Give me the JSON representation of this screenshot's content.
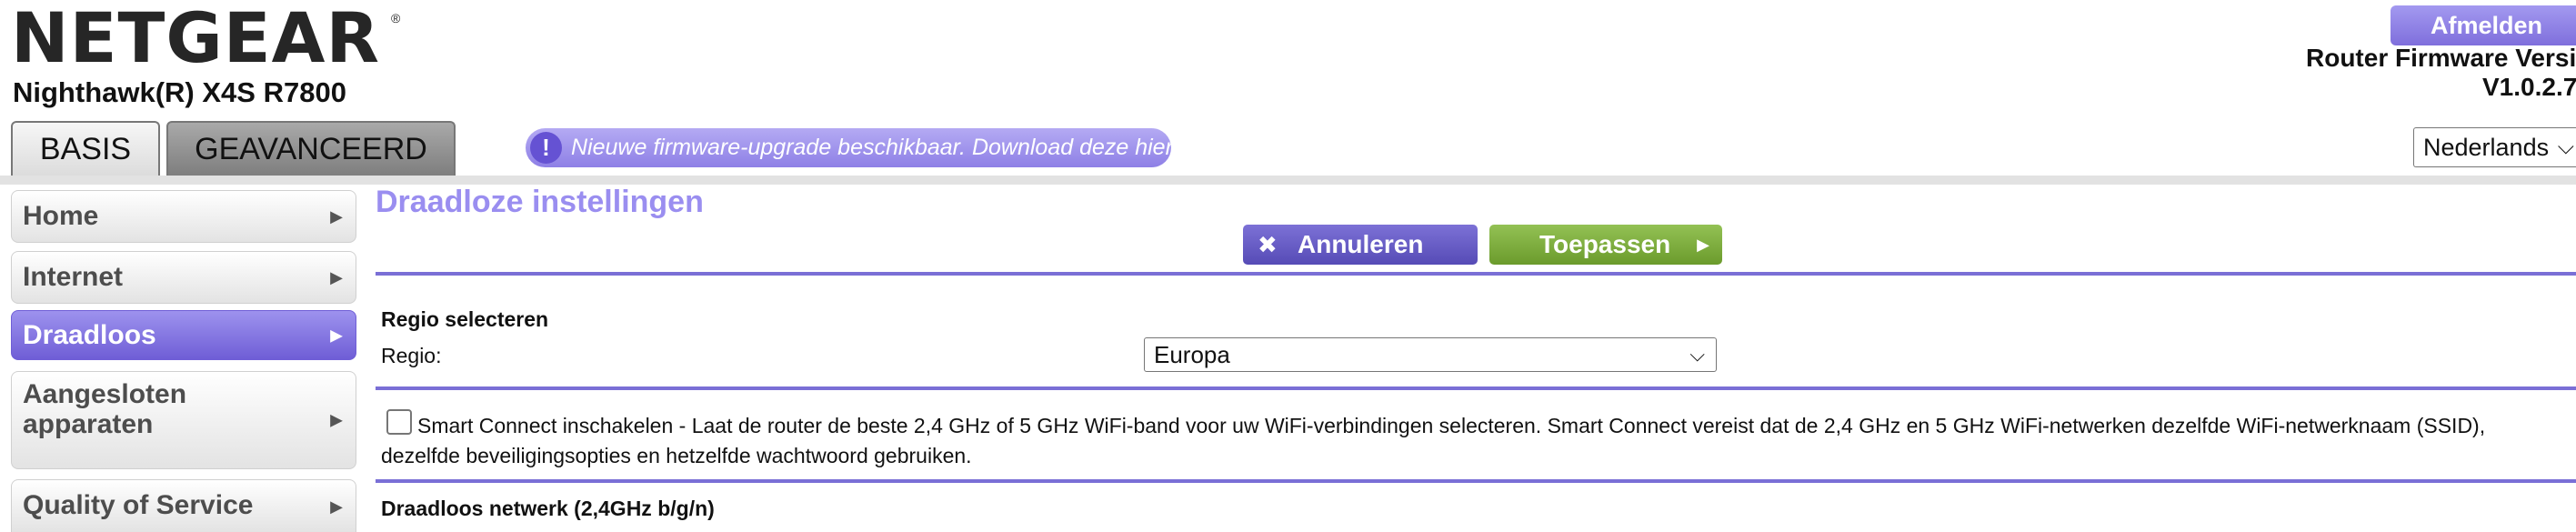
{
  "header": {
    "logo_text": "NETGEAR",
    "logo_mark": "®",
    "model": "Nighthawk(R) X4S R7800",
    "logout_label": "Afmelden",
    "firmware_label": "Router Firmware Versi",
    "firmware_version": "V1.0.2.7"
  },
  "tabs": [
    {
      "label": "BASIS",
      "active": true
    },
    {
      "label": "GEAVANCEERD",
      "active": false
    }
  ],
  "notice": {
    "icon": "exclamation-icon",
    "icon_glyph": "!",
    "text": "Nieuwe firmware-upgrade beschikbaar. Download deze hier."
  },
  "language": {
    "selected": "Nederlands"
  },
  "sidebar": {
    "items": [
      {
        "label": "Home"
      },
      {
        "label": "Internet"
      },
      {
        "label": "Draadloos",
        "active": true
      },
      {
        "label": "Aangesloten apparaten"
      },
      {
        "label": "Quality of Service"
      }
    ]
  },
  "main": {
    "title": "Draadloze instellingen",
    "cancel_label": "Annuleren",
    "apply_label": "Toepassen",
    "region_section_title": "Regio selecteren",
    "region_label": "Regio:",
    "region_value": "Europa",
    "smart_connect_checked": false,
    "smart_connect_text": "Smart Connect inschakelen - Laat de router de beste 2,4 GHz of 5 GHz WiFi-band voor uw WiFi-verbindingen selecteren. Smart Connect vereist dat de 2,4 GHz en 5 GHz WiFi-netwerken dezelfde WiFi-netwerknaam (SSID), dezelfde beveiligingsopties en hetzelfde wachtwoord gebruiken.",
    "wireless_24_title": "Draadloos netwerk (2,4GHz b/g/n)"
  },
  "colors": {
    "accent_purple": "#7a6fd6",
    "title_purple": "#9a8ef0",
    "apply_green": "#7fae3f"
  }
}
